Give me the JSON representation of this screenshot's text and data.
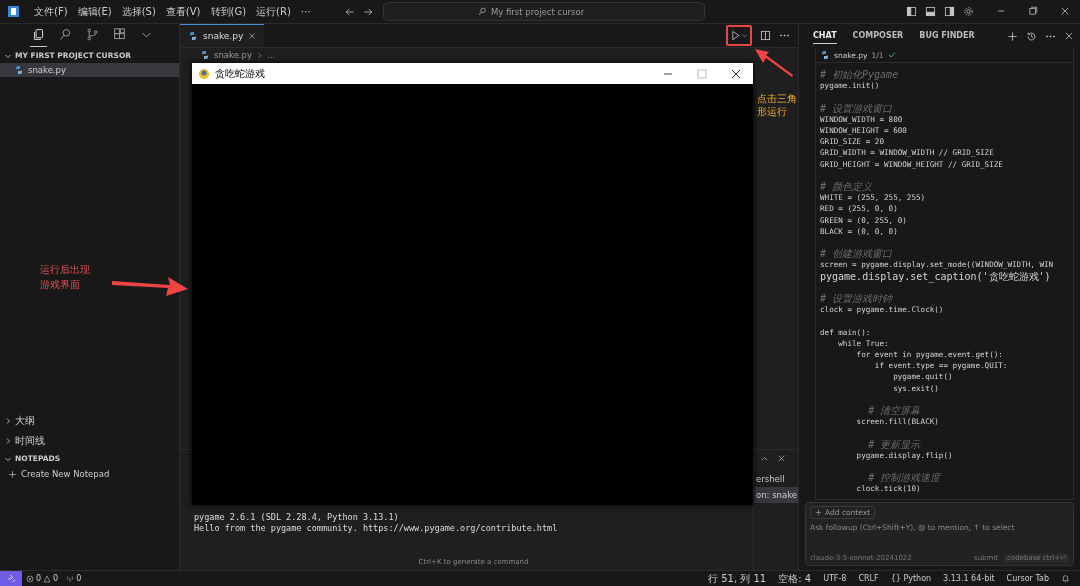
{
  "menu": [
    "文件(F)",
    "编辑(E)",
    "选择(S)",
    "查看(V)",
    "转到(G)",
    "运行(R)"
  ],
  "menu_more": "···",
  "search": {
    "value": "My first project cursor"
  },
  "activity": [
    {
      "kind": "files",
      "selected": true
    },
    {
      "kind": "search",
      "selected": false
    },
    {
      "kind": "branch",
      "selected": false
    },
    {
      "kind": "extensions",
      "selected": false
    },
    {
      "kind": "more",
      "selected": false
    }
  ],
  "explorer": {
    "title": "MY FIRST PROJECT CURSOR",
    "expanded": true,
    "files": [
      {
        "name": "snake.py",
        "selected": true
      }
    ]
  },
  "sections": [
    {
      "title": "大纲",
      "expanded": false
    },
    {
      "title": "时间线",
      "expanded": false
    },
    {
      "title": "NOTEPADS",
      "expanded": true
    }
  ],
  "notepad_action": "Create New Notepad",
  "annotations": [
    {
      "kind": "left",
      "text": "运行后出现游戏界面"
    },
    {
      "kind": "run",
      "text": "点击三角形运行"
    }
  ],
  "editor": {
    "tabs": [
      {
        "label": "snake.py",
        "selected": true
      }
    ],
    "breadcrumb": [
      "snake.py",
      "..."
    ]
  },
  "game_window": {
    "title": "贪吃蛇游戏"
  },
  "terminal": {
    "lines": [
      "pygame 2.6.1 (SDL 2.28.4, Python 3.13.1)",
      "Hello from the pygame community. https://www.pygame.org/contribute.html"
    ],
    "sessions": [
      {
        "label": "ershell",
        "selected": false
      },
      {
        "label": "on: snake",
        "selected": true
      }
    ],
    "hint": "Ctrl+K to generate a command"
  },
  "chat": {
    "tabs": [
      {
        "label": "CHAT",
        "selected": true
      },
      {
        "label": "COMPOSER",
        "selected": false
      },
      {
        "label": "BUG FINDER",
        "selected": false
      }
    ],
    "file": {
      "name": "snake.py",
      "count": "1/1",
      "applied": true
    },
    "code": [
      {
        "kind": "comment",
        "text": "# 初始化Pygame"
      },
      {
        "kind": "code",
        "text": "pygame.init()"
      },
      {
        "kind": "blank"
      },
      {
        "kind": "comment",
        "text": "# 设置游戏窗口"
      },
      {
        "kind": "code",
        "text": "WINDOW_WIDTH = 800"
      },
      {
        "kind": "code",
        "text": "WINDOW_HEIGHT = 600"
      },
      {
        "kind": "code",
        "text": "GRID_SIZE = 20"
      },
      {
        "kind": "code",
        "text": "GRID_WIDTH = WINDOW_WIDTH // GRID_SIZE"
      },
      {
        "kind": "code",
        "text": "GRID_HEIGHT = WINDOW_HEIGHT // GRID_SIZE"
      },
      {
        "kind": "blank"
      },
      {
        "kind": "comment",
        "text": "# 颜色定义"
      },
      {
        "kind": "code",
        "text": "WHITE = (255, 255, 255)"
      },
      {
        "kind": "code",
        "text": "RED = (255, 0, 0)"
      },
      {
        "kind": "code",
        "text": "GREEN = (0, 255, 0)"
      },
      {
        "kind": "code",
        "text": "BLACK = (0, 0, 0)"
      },
      {
        "kind": "blank"
      },
      {
        "kind": "comment",
        "text": "# 创建游戏窗口"
      },
      {
        "kind": "code",
        "text": "screen = pygame.display.set_mode((WINDOW_WIDTH, WIN"
      },
      {
        "kind": "code",
        "text": "pygame.display.set_caption('贪吃蛇游戏')"
      },
      {
        "kind": "blank"
      },
      {
        "kind": "comment",
        "text": "# 设置游戏时钟"
      },
      {
        "kind": "code",
        "text": "clock = pygame.time.Clock()"
      },
      {
        "kind": "blank"
      },
      {
        "kind": "code",
        "text": "def main():"
      },
      {
        "kind": "code",
        "text": "    while True:"
      },
      {
        "kind": "code",
        "text": "        for event in pygame.event.get():"
      },
      {
        "kind": "code",
        "text": "            if event.type == pygame.QUIT:"
      },
      {
        "kind": "code",
        "text": "                pygame.quit()"
      },
      {
        "kind": "code",
        "text": "                sys.exit()"
      },
      {
        "kind": "blank"
      },
      {
        "kind": "comment",
        "text": "        # 清空屏幕"
      },
      {
        "kind": "code",
        "text": "        screen.fill(BLACK)"
      },
      {
        "kind": "blank"
      },
      {
        "kind": "comment",
        "text": "        # 更新显示"
      },
      {
        "kind": "code",
        "text": "        pygame.display.flip()"
      },
      {
        "kind": "blank"
      },
      {
        "kind": "comment",
        "text": "        # 控制游戏速度"
      },
      {
        "kind": "code",
        "text": "        clock.tick(10)"
      }
    ],
    "add_context": "Add context",
    "input": {
      "placeholder": "Ask followup (Ctrl+Shift+Y), @ to mention, ↑ to select"
    },
    "model": "claude-3-5-sonnet-20241022",
    "submit": "submit",
    "codebase": "codebase ctrl+⏎"
  },
  "status": {
    "errors": "0",
    "warnings": "0",
    "ports": "0",
    "right": [
      "行 51, 列 11",
      "空格: 4",
      "UTF-8",
      "CRLF",
      "{} Python",
      "3.13.1 64-bit",
      "Cursor Tab"
    ]
  }
}
